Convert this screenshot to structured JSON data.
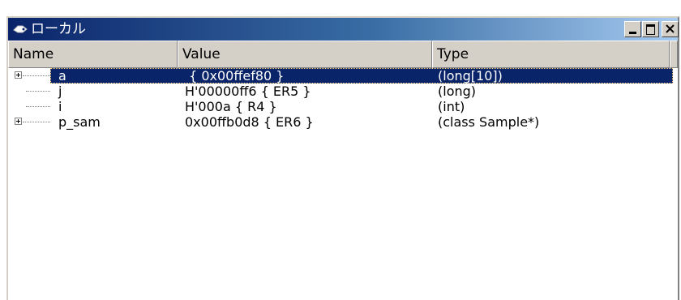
{
  "window": {
    "title": "ローカル",
    "minimize_icon": "minimize-icon",
    "maximize_icon": "maximize-icon",
    "close_icon": "close-icon",
    "app_icon": "locals-icon"
  },
  "columns": {
    "name": "Name",
    "value": "Value",
    "type": "Type"
  },
  "rows": [
    {
      "name": "a",
      "value": " { 0x00ffef80 }",
      "type": "(long[10])",
      "expandable": true,
      "selected": true
    },
    {
      "name": "j",
      "value": "H'00000ff6 { ER5 }",
      "type": "(long)",
      "expandable": false,
      "selected": false
    },
    {
      "name": "i",
      "value": "H'000a { R4 }",
      "type": "(int)",
      "expandable": false,
      "selected": false
    },
    {
      "name": "p_sam",
      "value": "0x00ffb0d8 { ER6 }",
      "type": "(class Sample*)",
      "expandable": true,
      "selected": false
    }
  ],
  "colors": {
    "titlebar_start": "#0a246a",
    "titlebar_end": "#a6caf0",
    "selection": "#0a246a",
    "chrome": "#d4d0c8"
  }
}
